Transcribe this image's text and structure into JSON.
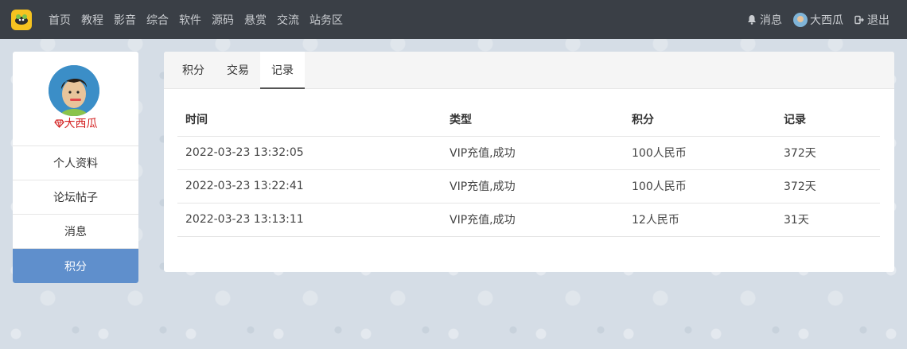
{
  "nav": {
    "logo_icon": "fly-logo-icon",
    "links": [
      "首页",
      "教程",
      "影音",
      "综合",
      "软件",
      "源码",
      "悬赏",
      "交流",
      "站务区"
    ],
    "messages_label": "消息",
    "username": "大西瓜",
    "logout_label": "退出"
  },
  "sidebar": {
    "username": "大西瓜",
    "items": [
      {
        "label": "个人资料"
      },
      {
        "label": "论坛帖子"
      },
      {
        "label": "消息"
      },
      {
        "label": "积分"
      }
    ],
    "active_index": 3
  },
  "panel": {
    "tabs": [
      {
        "label": "积分"
      },
      {
        "label": "交易"
      },
      {
        "label": "记录"
      }
    ],
    "active_tab": 2,
    "table": {
      "headers": [
        "时间",
        "类型",
        "积分",
        "记录"
      ],
      "rows": [
        [
          "2022-03-23 13:32:05",
          "VIP充值,成功",
          "100人民币",
          "372天"
        ],
        [
          "2022-03-23 13:22:41",
          "VIP充值,成功",
          "100人民币",
          "372天"
        ],
        [
          "2022-03-23 13:13:11",
          "VIP充值,成功",
          "12人民币",
          "31天"
        ]
      ]
    }
  },
  "colors": {
    "navbar_bg": "#3a3f46",
    "active_sidebar": "#5f8fcc",
    "username_red": "#d32121"
  }
}
